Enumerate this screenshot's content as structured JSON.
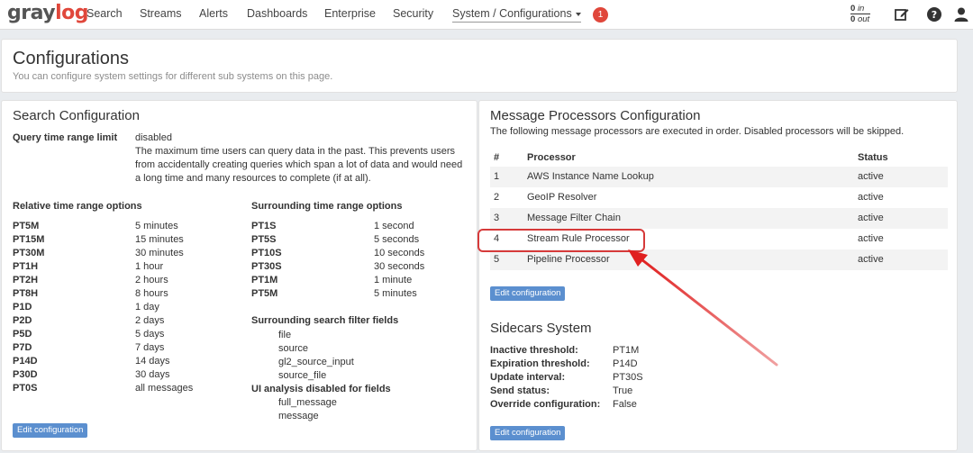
{
  "nav": {
    "brand_prefix": "gray",
    "brand_suffix": "log",
    "items": [
      {
        "label": "Search"
      },
      {
        "label": "Streams"
      },
      {
        "label": "Alerts"
      },
      {
        "label": "Dashboards"
      },
      {
        "label": "Enterprise"
      },
      {
        "label": "Security"
      },
      {
        "label": "System / Configurations"
      }
    ],
    "notification_count": "1",
    "throughput_in_value": "0",
    "throughput_in_label": "in",
    "throughput_out_value": "0",
    "throughput_out_label": "out"
  },
  "header": {
    "title": "Configurations",
    "subtitle": "You can configure system settings for different sub systems on this page."
  },
  "search_config": {
    "title": "Search Configuration",
    "query_limit_label": "Query time range limit",
    "query_limit_value": "disabled",
    "query_limit_desc": "The maximum time users can query data in the past. This prevents users from accidentally creating queries which span a lot of data and would need a long time and many resources to complete (if at all).",
    "relative_title": "Relative time range options",
    "relative": [
      {
        "k": "PT5M",
        "v": "5 minutes"
      },
      {
        "k": "PT15M",
        "v": "15 minutes"
      },
      {
        "k": "PT30M",
        "v": "30 minutes"
      },
      {
        "k": "PT1H",
        "v": "1 hour"
      },
      {
        "k": "PT2H",
        "v": "2 hours"
      },
      {
        "k": "PT8H",
        "v": "8 hours"
      },
      {
        "k": "P1D",
        "v": "1 day"
      },
      {
        "k": "P2D",
        "v": "2 days"
      },
      {
        "k": "P5D",
        "v": "5 days"
      },
      {
        "k": "P7D",
        "v": "7 days"
      },
      {
        "k": "P14D",
        "v": "14 days"
      },
      {
        "k": "P30D",
        "v": "30 days"
      },
      {
        "k": "PT0S",
        "v": "all messages"
      }
    ],
    "surrounding_title": "Surrounding time range options",
    "surrounding": [
      {
        "k": "PT1S",
        "v": "1 second"
      },
      {
        "k": "PT5S",
        "v": "5 seconds"
      },
      {
        "k": "PT10S",
        "v": "10 seconds"
      },
      {
        "k": "PT30S",
        "v": "30 seconds"
      },
      {
        "k": "PT1M",
        "v": "1 minute"
      },
      {
        "k": "PT5M",
        "v": "5 minutes"
      }
    ],
    "filter_title": "Surrounding search filter fields",
    "filter_fields": [
      "file",
      "source",
      "gl2_source_input",
      "source_file"
    ],
    "ui_title": "UI analysis disabled for fields",
    "ui_fields": [
      "full_message",
      "message"
    ],
    "edit_label": "Edit configuration"
  },
  "processors": {
    "title": "Message Processors Configuration",
    "subtitle": "The following message processors are executed in order. Disabled processors will be skipped.",
    "col_num": "#",
    "col_proc": "Processor",
    "col_status": "Status",
    "rows": [
      {
        "n": "1",
        "name": "AWS Instance Name Lookup",
        "status": "active"
      },
      {
        "n": "2",
        "name": "GeoIP Resolver",
        "status": "active"
      },
      {
        "n": "3",
        "name": "Message Filter Chain",
        "status": "active"
      },
      {
        "n": "4",
        "name": "Stream Rule Processor",
        "status": "active"
      },
      {
        "n": "5",
        "name": "Pipeline Processor",
        "status": "active"
      }
    ],
    "edit_label": "Edit configuration"
  },
  "sidecars": {
    "title": "Sidecars System",
    "items": [
      {
        "k": "Inactive threshold:",
        "v": "PT1M"
      },
      {
        "k": "Expiration threshold:",
        "v": "P14D"
      },
      {
        "k": "Update interval:",
        "v": "PT30S"
      },
      {
        "k": "Send status:",
        "v": "True"
      },
      {
        "k": "Override configuration:",
        "v": "False"
      }
    ],
    "edit_label": "Edit configuration"
  },
  "colors": {
    "brand_accent": "#e0473b",
    "button": "#5b8fcf",
    "annotation": "#d63a3a"
  }
}
